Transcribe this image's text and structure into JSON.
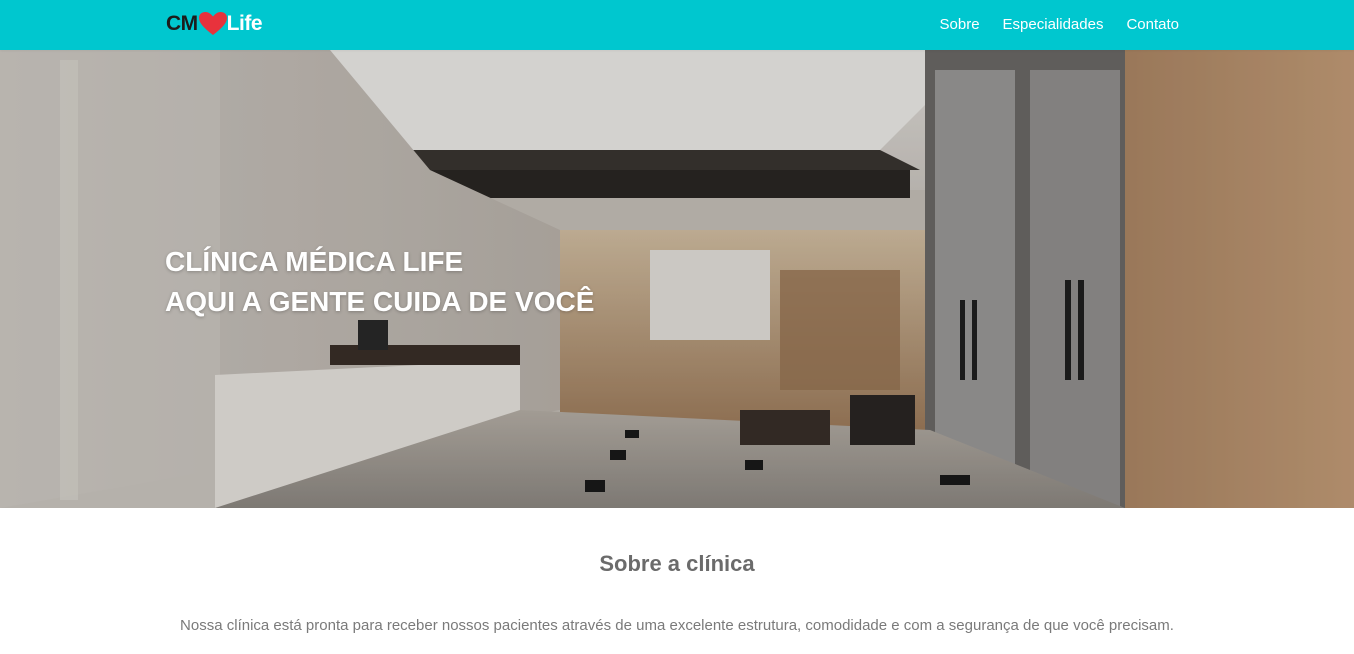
{
  "header": {
    "logo": {
      "part1": "CM",
      "heart_icon": "heart-icon",
      "part2": "Life"
    },
    "nav": [
      {
        "label": "Sobre"
      },
      {
        "label": "Especialidades"
      },
      {
        "label": "Contato"
      }
    ]
  },
  "hero": {
    "line1": "CLÍNICA MÉDICA LIFE",
    "line2": "AQUI A GENTE CUIDA DE VOCÊ"
  },
  "about": {
    "title": "Sobre a clínica",
    "text": "Nossa clínica está pronta para receber nossos pacientes através de uma excelente estrutura, comodidade e com a segurança de que você precisam."
  },
  "colors": {
    "header_bg": "#00c7cf",
    "heart": "#e8323c",
    "text_gray": "#6b6b6b"
  }
}
